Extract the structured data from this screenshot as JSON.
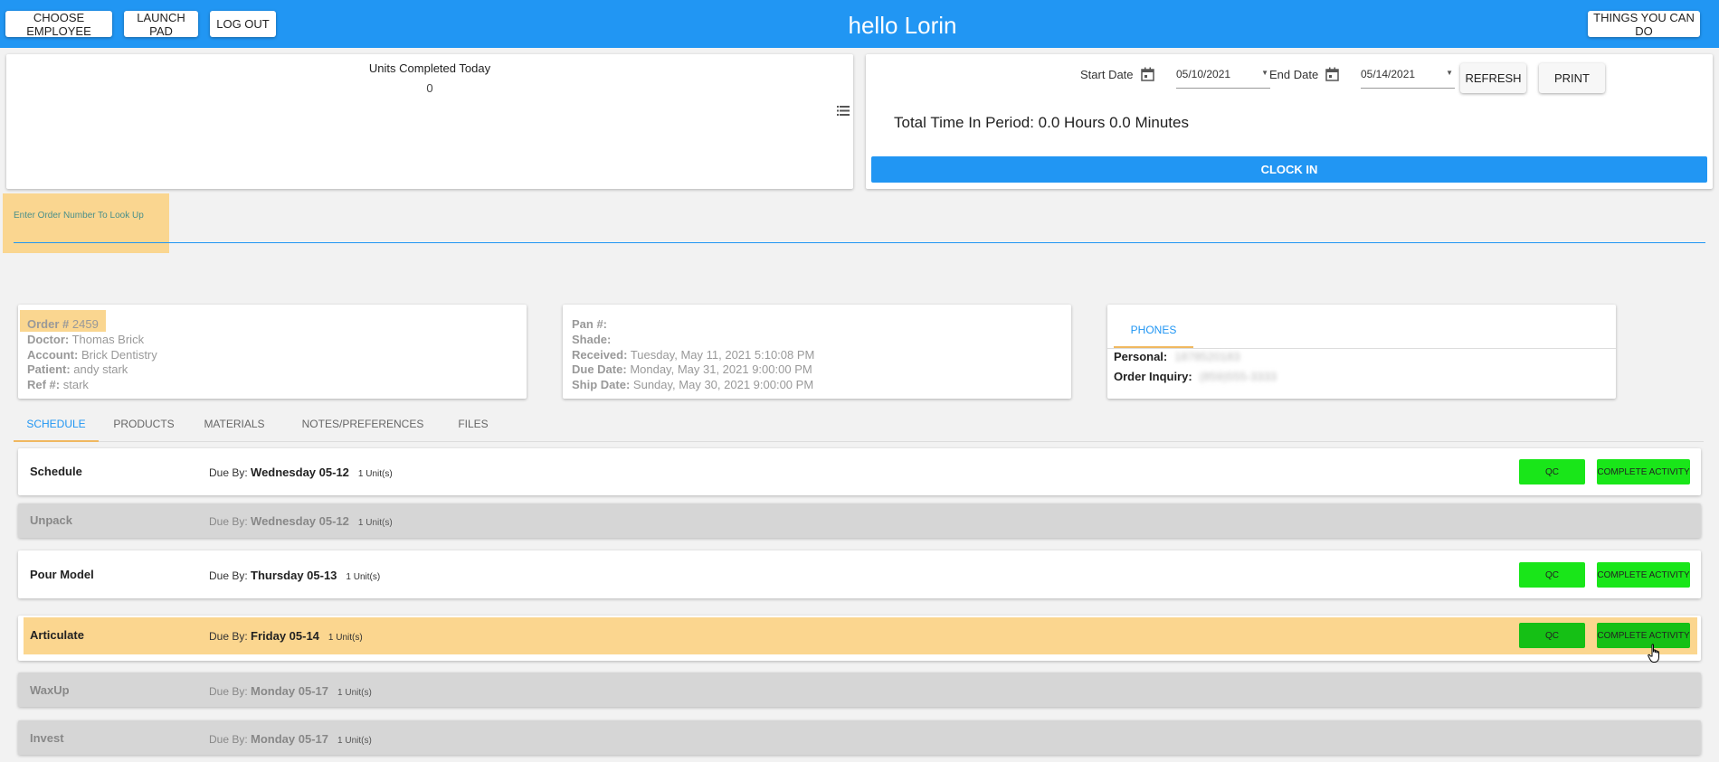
{
  "header": {
    "choose_employee": "CHOOSE EMPLOYEE",
    "launch_pad": "LAUNCH PAD",
    "log_out": "LOG OUT",
    "greeting": "hello Lorin",
    "things_you_can_do": "THINGS YOU CAN DO"
  },
  "units_card": {
    "title": "Units Completed Today",
    "value": "0"
  },
  "time_card": {
    "start_label": "Start Date",
    "start_value": "05/10/2021",
    "end_label": "End Date",
    "end_value": "05/14/2021",
    "refresh": "REFRESH",
    "print": "PRINT",
    "total_time": "Total Time In Period: 0.0 Hours 0.0 Minutes",
    "clock_in": "CLOCK IN"
  },
  "lookup": {
    "label": "Enter Order Number To Look Up",
    "value": ""
  },
  "order": {
    "order_label": "Order #",
    "order_value": "2459",
    "doctor_label": "Doctor:",
    "doctor_value": "Thomas Brick",
    "account_label": "Account:",
    "account_value": "Brick Dentistry",
    "patient_label": "Patient:",
    "patient_value": "andy stark",
    "ref_label": "Ref #:",
    "ref_value": "stark"
  },
  "case": {
    "pan_label": "Pan #:",
    "pan_value": "",
    "shade_label": "Shade:",
    "shade_value": "",
    "received_label": "Received:",
    "received_value": "Tuesday, May 11, 2021 5:10:08 PM",
    "due_label": "Due Date:",
    "due_value": "Monday, May 31, 2021 9:00:00 PM",
    "ship_label": "Ship Date:",
    "ship_value": "Sunday, May 30, 2021 9:00:00 PM"
  },
  "phones": {
    "tab": "PHONES",
    "personal_label": "Personal:",
    "personal_value": "1878520183",
    "inquiry_label": "Order Inquiry:",
    "inquiry_value": "(859)555-3333"
  },
  "tabs": [
    "SCHEDULE",
    "PRODUCTS",
    "MATERIALS",
    "NOTES/PREFERENCES",
    "FILES"
  ],
  "schedule": {
    "due_prefix": "Due By:",
    "qc_label": "QC",
    "complete_label": "COMPLETE ACTIVITY",
    "rows": [
      {
        "name": "Schedule",
        "due": "Wednesday 05-12",
        "units": "1 Unit(s)"
      },
      {
        "name": "Unpack",
        "due": "Wednesday 05-12",
        "units": "1 Unit(s)"
      },
      {
        "name": "Pour Model",
        "due": "Thursday 05-13",
        "units": "1 Unit(s)"
      },
      {
        "name": "Articulate",
        "due": "Friday 05-14",
        "units": "1 Unit(s)"
      },
      {
        "name": "WaxUp",
        "due": "Monday 05-17",
        "units": "1 Unit(s)"
      },
      {
        "name": "Invest",
        "due": "Monday 05-17",
        "units": "1 Unit(s)"
      }
    ]
  },
  "colors": {
    "primary": "#2196f3",
    "highlight": "#fad690",
    "action_green": "#19e619"
  }
}
